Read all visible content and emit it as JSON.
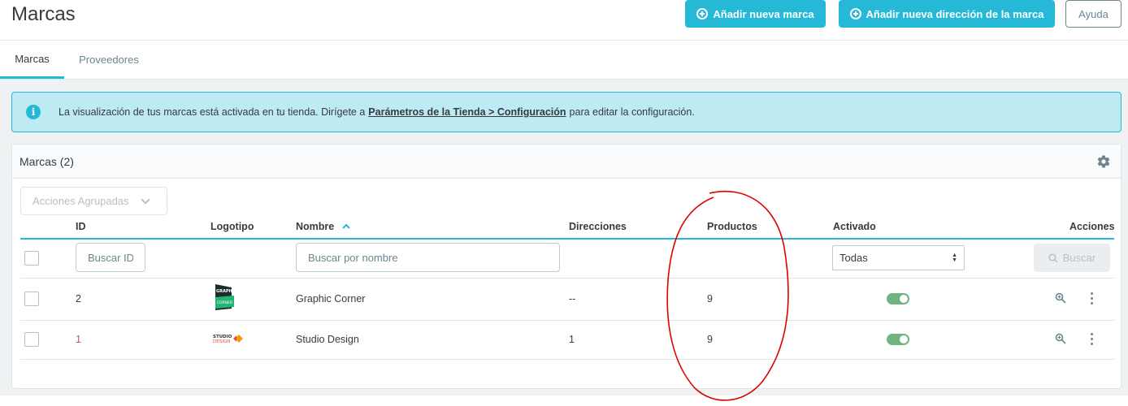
{
  "header": {
    "title": "Marcas",
    "add_brand_label": "Añadir nueva marca",
    "add_address_label": "Añadir nueva dirección de la marca",
    "help_label": "Ayuda"
  },
  "tabs": [
    {
      "label": "Marcas",
      "active": true
    },
    {
      "label": "Proveedores",
      "active": false
    }
  ],
  "alert": {
    "text_before": "La visualización de tus marcas está activada en tu tienda. Dirígete a",
    "link": "Parámetros de la Tienda > Configuración",
    "text_after": "para editar la configuración."
  },
  "card": {
    "title": "Marcas (2)",
    "bulk_actions_label": "Acciones Agrupadas",
    "columns": {
      "id": "ID",
      "logo": "Logotipo",
      "name": "Nombre",
      "addresses": "Direcciones",
      "products": "Productos",
      "active": "Activado",
      "actions": "Acciones"
    },
    "filters": {
      "id_placeholder": "Buscar ID",
      "name_placeholder": "Buscar por nombre",
      "active_selected": "Todas",
      "search_label": "Buscar"
    },
    "rows": [
      {
        "id": "2",
        "logo": "GRAPHIC CORNER",
        "name": "Graphic Corner",
        "addresses": "--",
        "products": "9",
        "active": true
      },
      {
        "id": "1",
        "logo": "STUDIO DESIGN",
        "name": "Studio Design",
        "addresses": "1",
        "products": "9",
        "active": true
      }
    ]
  },
  "colors": {
    "accent": "#25b9d7",
    "toggle_on": "#70b580",
    "annotation": "#e00000"
  }
}
